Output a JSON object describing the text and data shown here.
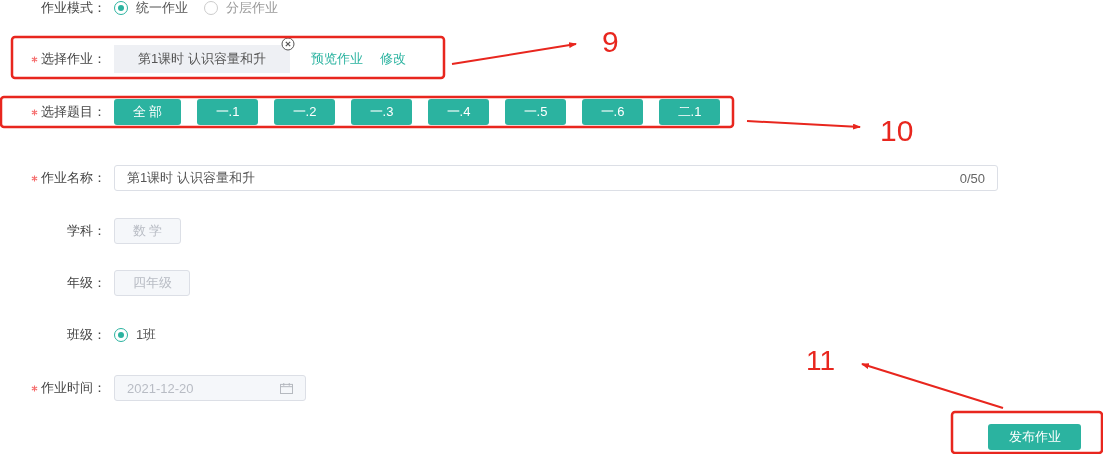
{
  "mode": {
    "label": "作业模式：",
    "options": [
      {
        "label": "统一作业",
        "selected": true
      },
      {
        "label": "分层作业",
        "selected": false
      }
    ]
  },
  "homework": {
    "label": "选择作业：",
    "required": true,
    "value": "第1课时 认识容量和升",
    "links": [
      "预览作业",
      "修改"
    ]
  },
  "questions": {
    "label": "选择题目：",
    "required": true,
    "items": [
      "全 部",
      "一.1",
      "一.2",
      "一.3",
      "一.4",
      "一.5",
      "一.6",
      "二.1"
    ]
  },
  "name": {
    "label": "作业名称：",
    "required": true,
    "value": "第1课时 认识容量和升",
    "counter": "0/50"
  },
  "subject": {
    "label": "学科：",
    "required": false,
    "value": "数 学"
  },
  "grade": {
    "label": "年级：",
    "required": false,
    "value": "四年级"
  },
  "class": {
    "label": "班级：",
    "required": false,
    "options": [
      {
        "label": "1班",
        "selected": true
      }
    ]
  },
  "time": {
    "label": "作业时间：",
    "required": true,
    "value": "2021-12-20"
  },
  "publish": {
    "label": "发布作业"
  },
  "annotations": [
    {
      "label": "9"
    },
    {
      "label": "10"
    },
    {
      "label": "11"
    }
  ]
}
